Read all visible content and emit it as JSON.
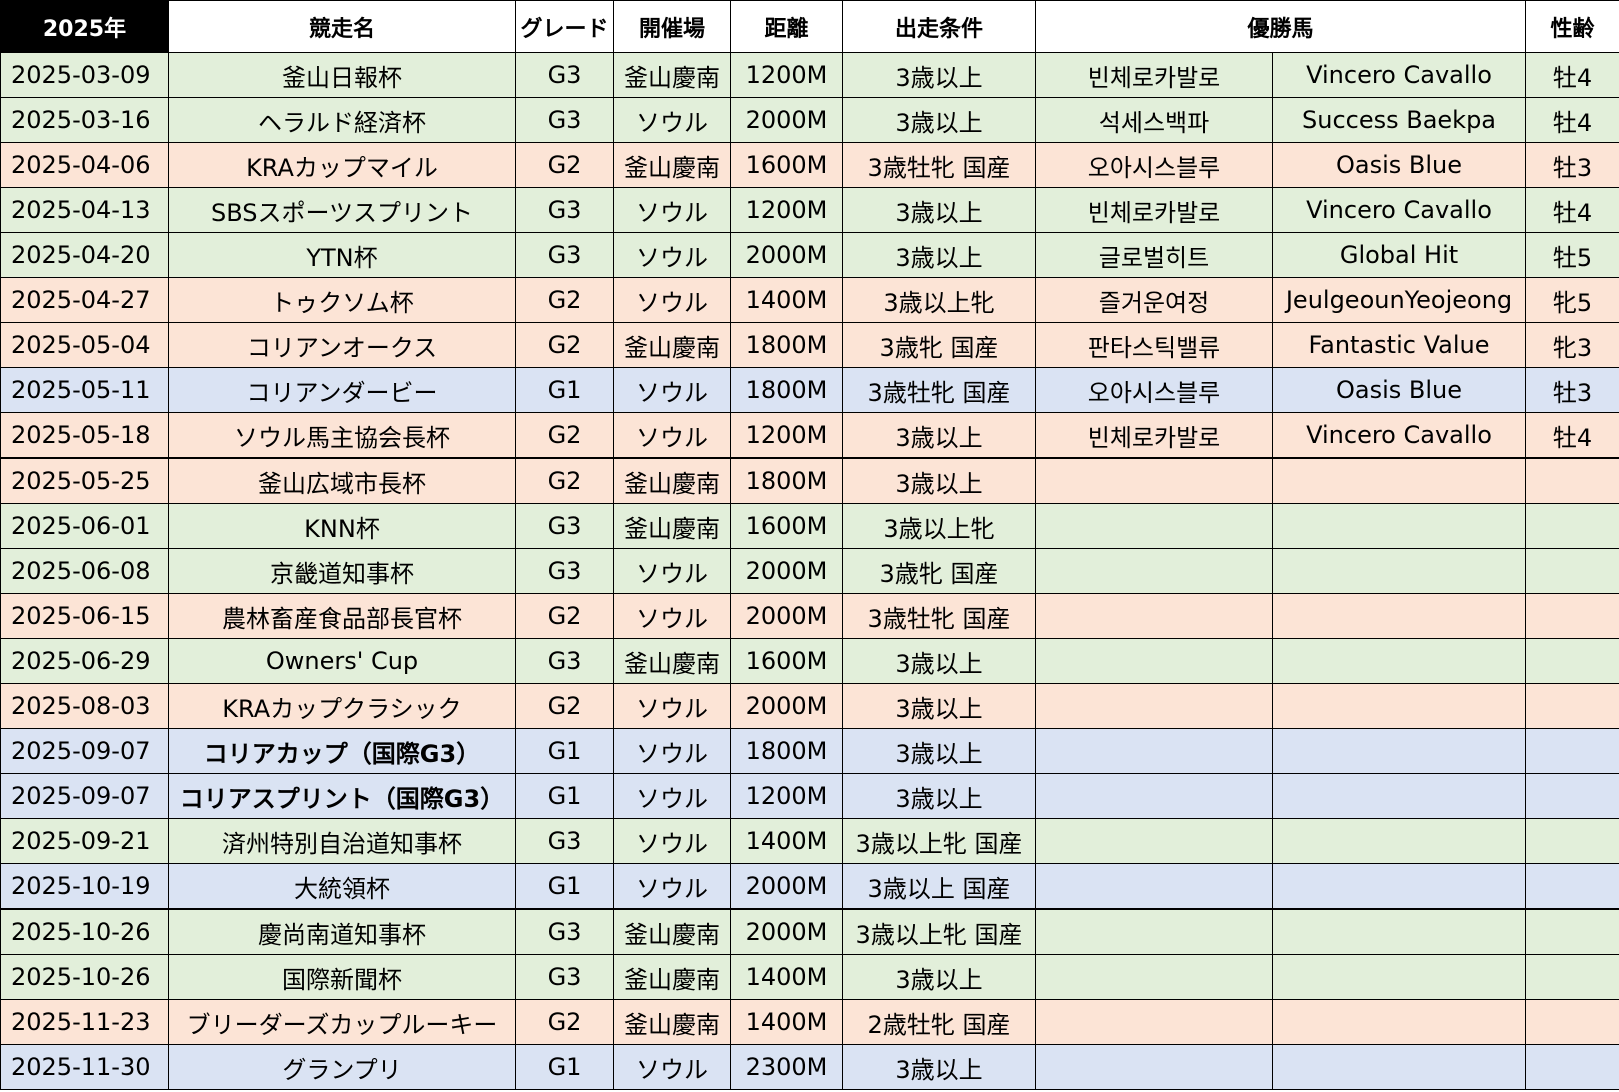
{
  "header": {
    "year": "2025年",
    "race_name": "競走名",
    "grade": "グレード",
    "venue": "開催場",
    "distance": "距離",
    "conditions": "出走条件",
    "winner": "優勝馬",
    "sex_age": "性齢"
  },
  "grade_colors": {
    "G1": "#dae3f3",
    "G2": "#fce4d6",
    "G3": "#e2efda"
  },
  "rows": [
    {
      "date": "2025-03-09",
      "race": "釜山日報杯",
      "grade": "G3",
      "venue": "釜山慶南",
      "distance": "1200M",
      "conditions": "3歳以上",
      "winner_ko": "빈체로카발로",
      "winner_en": "Vincero Cavallo",
      "sex_age": "牡4"
    },
    {
      "date": "2025-03-16",
      "race": "ヘラルド経済杯",
      "grade": "G3",
      "venue": "ソウル",
      "distance": "2000M",
      "conditions": "3歳以上",
      "winner_ko": "석세스백파",
      "winner_en": "Success Baekpa",
      "sex_age": "牡4"
    },
    {
      "date": "2025-04-06",
      "race": "KRAカップマイル",
      "grade": "G2",
      "venue": "釜山慶南",
      "distance": "1600M",
      "conditions": "3歳牡牝 国産",
      "winner_ko": "오아시스블루",
      "winner_en": "Oasis Blue",
      "sex_age": "牡3"
    },
    {
      "date": "2025-04-13",
      "race": "SBSスポーツスプリント",
      "grade": "G3",
      "venue": "ソウル",
      "distance": "1200M",
      "conditions": "3歳以上",
      "winner_ko": "빈체로카발로",
      "winner_en": "Vincero Cavallo",
      "sex_age": "牡4"
    },
    {
      "date": "2025-04-20",
      "race": "YTN杯",
      "grade": "G3",
      "venue": "ソウル",
      "distance": "2000M",
      "conditions": "3歳以上",
      "winner_ko": "글로벌히트",
      "winner_en": "Global Hit",
      "sex_age": "牡5"
    },
    {
      "date": "2025-04-27",
      "race": "トゥクソム杯",
      "grade": "G2",
      "venue": "ソウル",
      "distance": "1400M",
      "conditions": "3歳以上牝",
      "winner_ko": "즐거운여정",
      "winner_en": "JeulgeounYeojeong",
      "sex_age": "牝5"
    },
    {
      "date": "2025-05-04",
      "race": "コリアンオークス",
      "grade": "G2",
      "venue": "釜山慶南",
      "distance": "1800M",
      "conditions": "3歳牝 国産",
      "winner_ko": "판타스틱밸류",
      "winner_en": "Fantastic Value",
      "sex_age": "牝3"
    },
    {
      "date": "2025-05-11",
      "race": "コリアンダービー",
      "grade": "G1",
      "venue": "ソウル",
      "distance": "1800M",
      "conditions": "3歳牡牝 国産",
      "winner_ko": "오아시스블루",
      "winner_en": "Oasis Blue",
      "sex_age": "牡3"
    },
    {
      "date": "2025-05-18",
      "race": "ソウル馬主協会長杯",
      "grade": "G2",
      "venue": "ソウル",
      "distance": "1200M",
      "conditions": "3歳以上",
      "winner_ko": "빈체로카발로",
      "winner_en": "Vincero Cavallo",
      "sex_age": "牡4"
    },
    {
      "date": "2025-05-25",
      "race": "釜山広域市長杯",
      "grade": "G2",
      "venue": "釜山慶南",
      "distance": "1800M",
      "conditions": "3歳以上",
      "winner_ko": "",
      "winner_en": "",
      "sex_age": ""
    },
    {
      "date": "2025-06-01",
      "race": "KNN杯",
      "grade": "G3",
      "venue": "釜山慶南",
      "distance": "1600M",
      "conditions": "3歳以上牝",
      "winner_ko": "",
      "winner_en": "",
      "sex_age": ""
    },
    {
      "date": "2025-06-08",
      "race": "京畿道知事杯",
      "grade": "G3",
      "venue": "ソウル",
      "distance": "2000M",
      "conditions": "3歳牝 国産",
      "winner_ko": "",
      "winner_en": "",
      "sex_age": ""
    },
    {
      "date": "2025-06-15",
      "race": "農林畜産食品部長官杯",
      "grade": "G2",
      "venue": "ソウル",
      "distance": "2000M",
      "conditions": "3歳牡牝 国産",
      "winner_ko": "",
      "winner_en": "",
      "sex_age": ""
    },
    {
      "date": "2025-06-29",
      "race": "Owners' Cup",
      "grade": "G3",
      "venue": "釜山慶南",
      "distance": "1600M",
      "conditions": "3歳以上",
      "winner_ko": "",
      "winner_en": "",
      "sex_age": ""
    },
    {
      "date": "2025-08-03",
      "race": "KRAカップクラシック",
      "grade": "G2",
      "venue": "ソウル",
      "distance": "2000M",
      "conditions": "3歳以上",
      "winner_ko": "",
      "winner_en": "",
      "sex_age": ""
    },
    {
      "date": "2025-09-07",
      "race": "コリアカップ（国際G3）",
      "grade": "G1",
      "venue": "ソウル",
      "distance": "1800M",
      "conditions": "3歳以上",
      "winner_ko": "",
      "winner_en": "",
      "sex_age": "",
      "bold": true
    },
    {
      "date": "2025-09-07",
      "race": "コリアスプリント（国際G3）",
      "grade": "G1",
      "venue": "ソウル",
      "distance": "1200M",
      "conditions": "3歳以上",
      "winner_ko": "",
      "winner_en": "",
      "sex_age": "",
      "bold": true
    },
    {
      "date": "2025-09-21",
      "race": "済州特別自治道知事杯",
      "grade": "G3",
      "venue": "ソウル",
      "distance": "1400M",
      "conditions": "3歳以上牝 国産",
      "winner_ko": "",
      "winner_en": "",
      "sex_age": ""
    },
    {
      "date": "2025-10-19",
      "race": "大統領杯",
      "grade": "G1",
      "venue": "ソウル",
      "distance": "2000M",
      "conditions": "3歳以上 国産",
      "winner_ko": "",
      "winner_en": "",
      "sex_age": ""
    },
    {
      "date": "2025-10-26",
      "race": "慶尚南道知事杯",
      "grade": "G3",
      "venue": "釜山慶南",
      "distance": "2000M",
      "conditions": "3歳以上牝 国産",
      "winner_ko": "",
      "winner_en": "",
      "sex_age": ""
    },
    {
      "date": "2025-10-26",
      "race": "国際新聞杯",
      "grade": "G3",
      "venue": "釜山慶南",
      "distance": "1400M",
      "conditions": "3歳以上",
      "winner_ko": "",
      "winner_en": "",
      "sex_age": ""
    },
    {
      "date": "2025-11-23",
      "race": "ブリーダーズカップルーキー",
      "grade": "G2",
      "venue": "釜山慶南",
      "distance": "1400M",
      "conditions": "2歳牡牝 国産",
      "winner_ko": "",
      "winner_en": "",
      "sex_age": ""
    },
    {
      "date": "2025-11-30",
      "race": "グランプリ",
      "grade": "G1",
      "venue": "ソウル",
      "distance": "2300M",
      "conditions": "3歳以上",
      "winner_ko": "",
      "winner_en": "",
      "sex_age": ""
    }
  ]
}
